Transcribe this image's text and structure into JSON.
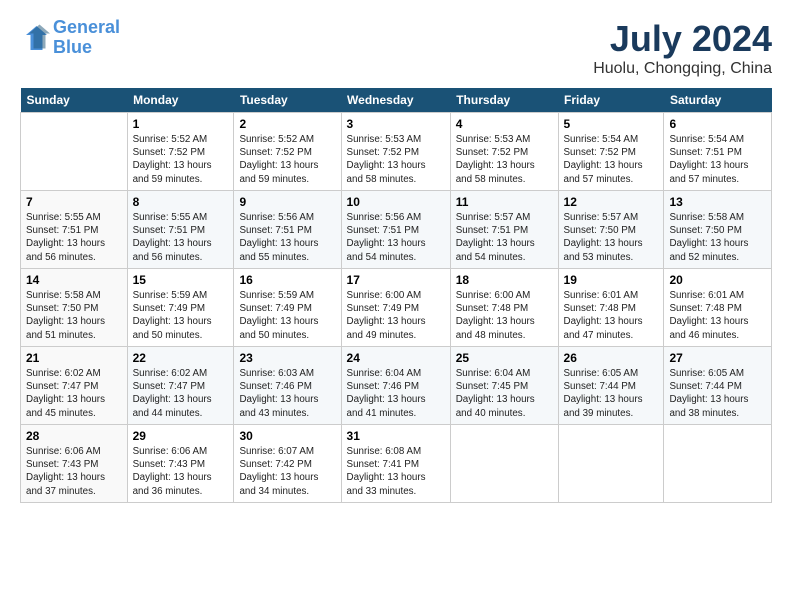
{
  "logo": {
    "line1": "General",
    "line2": "Blue"
  },
  "title": "July 2024",
  "subtitle": "Huolu, Chongqing, China",
  "headers": [
    "Sunday",
    "Monday",
    "Tuesday",
    "Wednesday",
    "Thursday",
    "Friday",
    "Saturday"
  ],
  "weeks": [
    [
      {
        "num": "",
        "info": ""
      },
      {
        "num": "1",
        "info": "Sunrise: 5:52 AM\nSunset: 7:52 PM\nDaylight: 13 hours\nand 59 minutes."
      },
      {
        "num": "2",
        "info": "Sunrise: 5:52 AM\nSunset: 7:52 PM\nDaylight: 13 hours\nand 59 minutes."
      },
      {
        "num": "3",
        "info": "Sunrise: 5:53 AM\nSunset: 7:52 PM\nDaylight: 13 hours\nand 58 minutes."
      },
      {
        "num": "4",
        "info": "Sunrise: 5:53 AM\nSunset: 7:52 PM\nDaylight: 13 hours\nand 58 minutes."
      },
      {
        "num": "5",
        "info": "Sunrise: 5:54 AM\nSunset: 7:52 PM\nDaylight: 13 hours\nand 57 minutes."
      },
      {
        "num": "6",
        "info": "Sunrise: 5:54 AM\nSunset: 7:51 PM\nDaylight: 13 hours\nand 57 minutes."
      }
    ],
    [
      {
        "num": "7",
        "info": "Sunrise: 5:55 AM\nSunset: 7:51 PM\nDaylight: 13 hours\nand 56 minutes."
      },
      {
        "num": "8",
        "info": "Sunrise: 5:55 AM\nSunset: 7:51 PM\nDaylight: 13 hours\nand 56 minutes."
      },
      {
        "num": "9",
        "info": "Sunrise: 5:56 AM\nSunset: 7:51 PM\nDaylight: 13 hours\nand 55 minutes."
      },
      {
        "num": "10",
        "info": "Sunrise: 5:56 AM\nSunset: 7:51 PM\nDaylight: 13 hours\nand 54 minutes."
      },
      {
        "num": "11",
        "info": "Sunrise: 5:57 AM\nSunset: 7:51 PM\nDaylight: 13 hours\nand 54 minutes."
      },
      {
        "num": "12",
        "info": "Sunrise: 5:57 AM\nSunset: 7:50 PM\nDaylight: 13 hours\nand 53 minutes."
      },
      {
        "num": "13",
        "info": "Sunrise: 5:58 AM\nSunset: 7:50 PM\nDaylight: 13 hours\nand 52 minutes."
      }
    ],
    [
      {
        "num": "14",
        "info": "Sunrise: 5:58 AM\nSunset: 7:50 PM\nDaylight: 13 hours\nand 51 minutes."
      },
      {
        "num": "15",
        "info": "Sunrise: 5:59 AM\nSunset: 7:49 PM\nDaylight: 13 hours\nand 50 minutes."
      },
      {
        "num": "16",
        "info": "Sunrise: 5:59 AM\nSunset: 7:49 PM\nDaylight: 13 hours\nand 50 minutes."
      },
      {
        "num": "17",
        "info": "Sunrise: 6:00 AM\nSunset: 7:49 PM\nDaylight: 13 hours\nand 49 minutes."
      },
      {
        "num": "18",
        "info": "Sunrise: 6:00 AM\nSunset: 7:48 PM\nDaylight: 13 hours\nand 48 minutes."
      },
      {
        "num": "19",
        "info": "Sunrise: 6:01 AM\nSunset: 7:48 PM\nDaylight: 13 hours\nand 47 minutes."
      },
      {
        "num": "20",
        "info": "Sunrise: 6:01 AM\nSunset: 7:48 PM\nDaylight: 13 hours\nand 46 minutes."
      }
    ],
    [
      {
        "num": "21",
        "info": "Sunrise: 6:02 AM\nSunset: 7:47 PM\nDaylight: 13 hours\nand 45 minutes."
      },
      {
        "num": "22",
        "info": "Sunrise: 6:02 AM\nSunset: 7:47 PM\nDaylight: 13 hours\nand 44 minutes."
      },
      {
        "num": "23",
        "info": "Sunrise: 6:03 AM\nSunset: 7:46 PM\nDaylight: 13 hours\nand 43 minutes."
      },
      {
        "num": "24",
        "info": "Sunrise: 6:04 AM\nSunset: 7:46 PM\nDaylight: 13 hours\nand 41 minutes."
      },
      {
        "num": "25",
        "info": "Sunrise: 6:04 AM\nSunset: 7:45 PM\nDaylight: 13 hours\nand 40 minutes."
      },
      {
        "num": "26",
        "info": "Sunrise: 6:05 AM\nSunset: 7:44 PM\nDaylight: 13 hours\nand 39 minutes."
      },
      {
        "num": "27",
        "info": "Sunrise: 6:05 AM\nSunset: 7:44 PM\nDaylight: 13 hours\nand 38 minutes."
      }
    ],
    [
      {
        "num": "28",
        "info": "Sunrise: 6:06 AM\nSunset: 7:43 PM\nDaylight: 13 hours\nand 37 minutes."
      },
      {
        "num": "29",
        "info": "Sunrise: 6:06 AM\nSunset: 7:43 PM\nDaylight: 13 hours\nand 36 minutes."
      },
      {
        "num": "30",
        "info": "Sunrise: 6:07 AM\nSunset: 7:42 PM\nDaylight: 13 hours\nand 34 minutes."
      },
      {
        "num": "31",
        "info": "Sunrise: 6:08 AM\nSunset: 7:41 PM\nDaylight: 13 hours\nand 33 minutes."
      },
      {
        "num": "",
        "info": ""
      },
      {
        "num": "",
        "info": ""
      },
      {
        "num": "",
        "info": ""
      }
    ]
  ]
}
